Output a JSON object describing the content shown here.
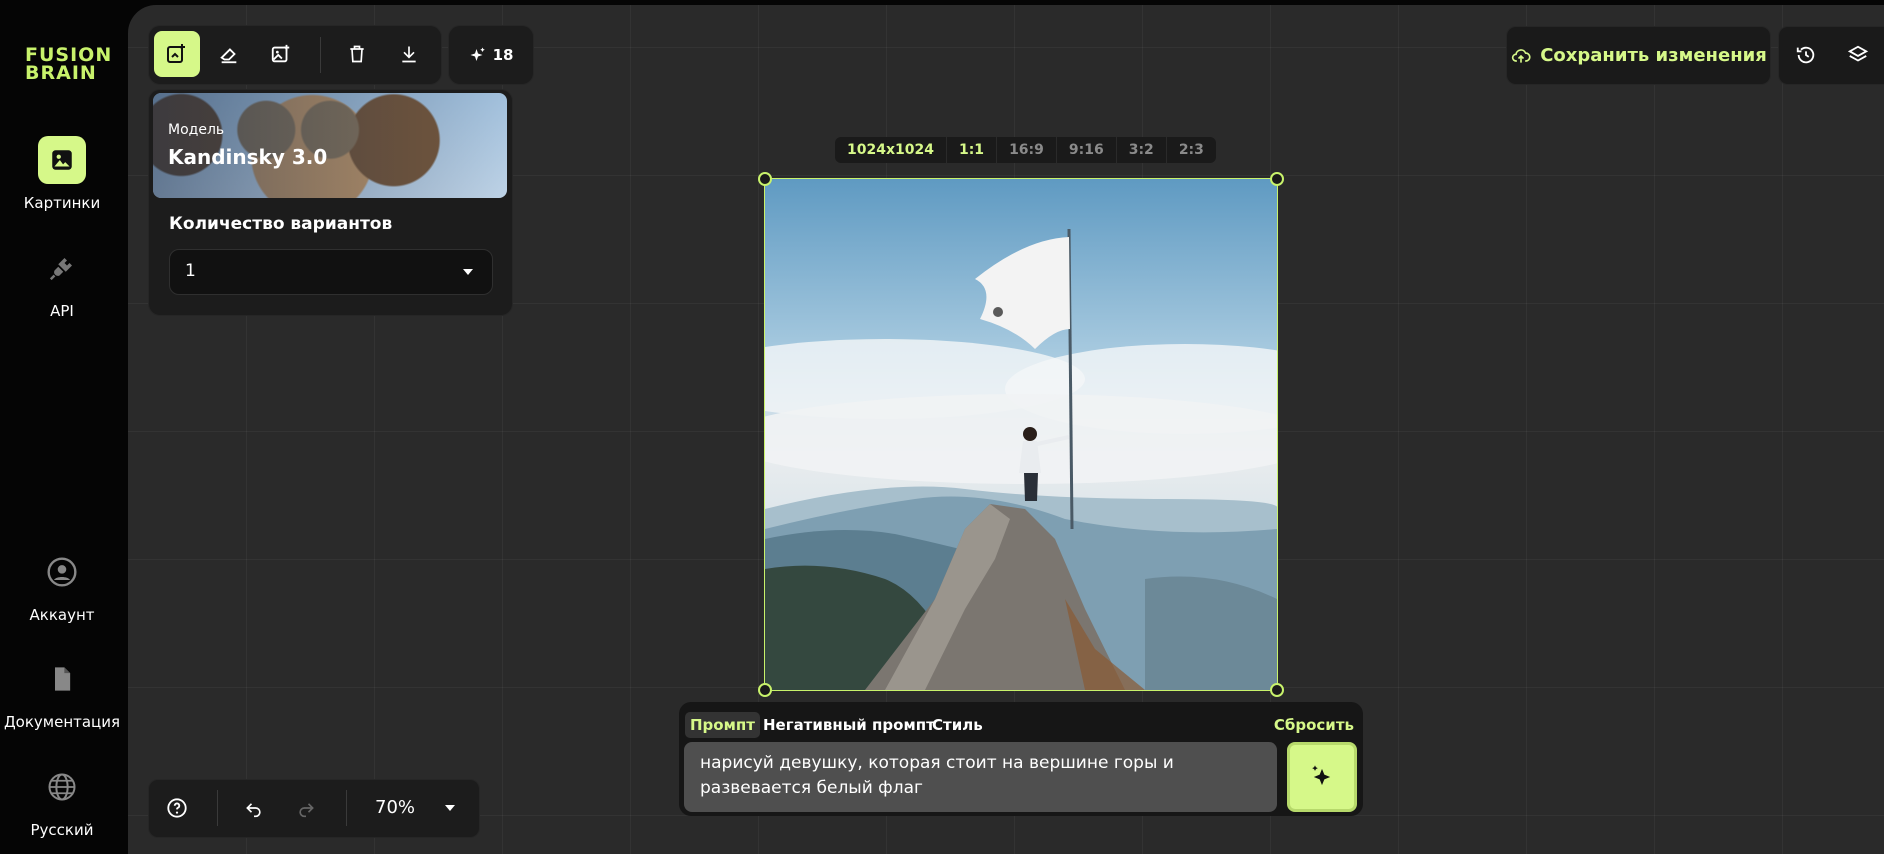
{
  "brand": {
    "line1": "FUSION",
    "line2": "BRAIN",
    "color": "#c8f26b"
  },
  "sidebar": {
    "items": [
      {
        "label": "Картинки",
        "icon": "image-icon",
        "active": true
      },
      {
        "label": "API",
        "icon": "plug-icon",
        "active": false
      },
      {
        "label": "Аккаунт",
        "icon": "user-icon",
        "active": false
      },
      {
        "label": "Документация",
        "icon": "document-icon",
        "active": false
      },
      {
        "label": "Русский",
        "icon": "globe-icon",
        "active": false
      }
    ]
  },
  "toolbar": {
    "tools": [
      "new-image-icon",
      "eraser-icon",
      "image-edit-icon",
      "trash-icon",
      "download-icon"
    ],
    "credits": "18"
  },
  "model": {
    "caption": "Модель",
    "name": "Kandinsky 3.0"
  },
  "variants": {
    "label": "Количество вариантов",
    "value": "1"
  },
  "ratios": {
    "resolution": "1024x1024",
    "options": [
      "1:1",
      "16:9",
      "9:16",
      "3:2",
      "2:3"
    ],
    "selected": "1:1"
  },
  "prompt": {
    "tabs": [
      "Промпт",
      "Негативный промпт",
      "Стиль"
    ],
    "active_tab": "Промпт",
    "reset": "Сбросить",
    "text_line1": "нарисуй девушку, которая стоит на вершине горы и",
    "text_line2": "развевается белый флаг"
  },
  "header": {
    "save_label": "Сохранить изменения"
  },
  "zoom": {
    "value": "70%"
  },
  "colors": {
    "accent": "#d6f889",
    "panel": "#1c1c1c",
    "canvas": "#2a2a2a"
  }
}
